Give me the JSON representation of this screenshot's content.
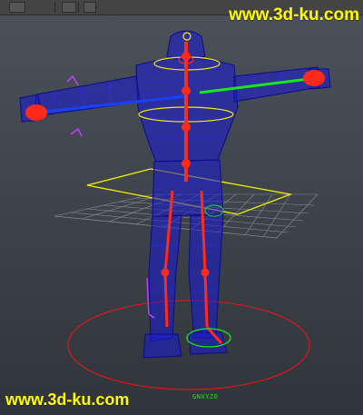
{
  "watermark_top": "www.3d-ku.com",
  "watermark_bottom": "www.3d-ku.com",
  "axis_label": "GNXYZO",
  "colors": {
    "watermark": "#ffff00",
    "mesh": "#1a1ad6",
    "spine": "#ff2a1a",
    "left_arm": "#18e818",
    "right_arm": "#1840ff",
    "control_yellow": "#f6f000",
    "control_red": "#e0151a",
    "control_magenta": "#c040ff",
    "grid": "#9aa0a6"
  },
  "icons": [
    "toolbar-button",
    "grid-floor",
    "character-mesh",
    "spine-joint-chain",
    "arm-joint-chain",
    "leg-joint-chain",
    "root-control-circle",
    "hip-control-square",
    "shoulder-control-ring",
    "hand-ik-control",
    "foot-ik-control"
  ]
}
